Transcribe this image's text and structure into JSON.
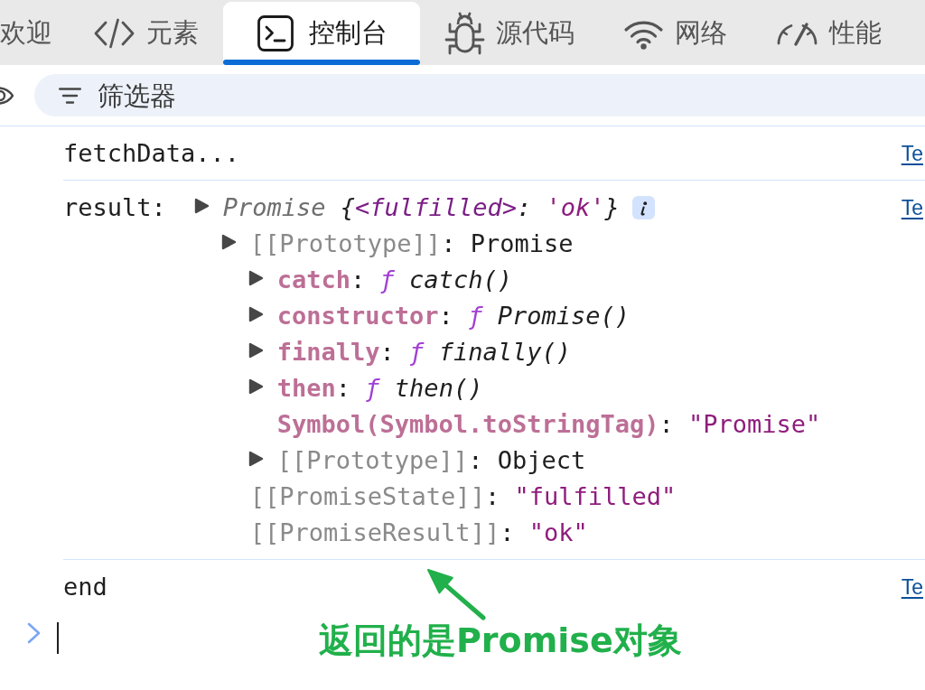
{
  "tabs": [
    {
      "label": "欢迎",
      "kind": "welcome",
      "selected": false
    },
    {
      "label": "元素",
      "kind": "elements",
      "selected": false
    },
    {
      "label": "控制台",
      "kind": "console",
      "selected": true
    },
    {
      "label": "源代码",
      "kind": "sources",
      "selected": false
    },
    {
      "label": "网络",
      "kind": "network",
      "selected": false
    },
    {
      "label": "性能",
      "kind": "performance",
      "selected": false
    }
  ],
  "filter": {
    "placeholder": "筛选器"
  },
  "messages": [
    {
      "kind": "text",
      "text": "fetchData...",
      "source": "Te"
    },
    {
      "kind": "object",
      "label": "result:",
      "expandable": true,
      "parts": [
        {
          "kind": "class",
          "text": "Promise "
        },
        {
          "kind": "punct",
          "text": "{"
        },
        {
          "kind": "tag",
          "text": "<fulfilled>"
        },
        {
          "kind": "punct",
          "text": ": "
        },
        {
          "kind": "str",
          "text": "'ok'"
        },
        {
          "kind": "punct",
          "text": "}"
        }
      ],
      "source": "Te",
      "children": [
        {
          "expandable": true,
          "parts": [
            {
              "kind": "internal",
              "text": "[[Prototype]]"
            },
            {
              "kind": "punct",
              "text": ": "
            },
            {
              "kind": "plain",
              "text": "Promise"
            }
          ],
          "children": [
            {
              "expandable": true,
              "parts": [
                {
                  "kind": "key",
                  "text": "catch"
                },
                {
                  "kind": "punct",
                  "text": ": "
                },
                {
                  "kind": "fn",
                  "text": "ƒ "
                },
                {
                  "kind": "call",
                  "text": "catch()"
                }
              ]
            },
            {
              "expandable": true,
              "parts": [
                {
                  "kind": "key",
                  "text": "constructor"
                },
                {
                  "kind": "punct",
                  "text": ": "
                },
                {
                  "kind": "fn",
                  "text": "ƒ "
                },
                {
                  "kind": "call",
                  "text": "Promise()"
                }
              ]
            },
            {
              "expandable": true,
              "parts": [
                {
                  "kind": "key",
                  "text": "finally"
                },
                {
                  "kind": "punct",
                  "text": ": "
                },
                {
                  "kind": "fn",
                  "text": "ƒ "
                },
                {
                  "kind": "call",
                  "text": "finally()"
                }
              ]
            },
            {
              "expandable": true,
              "parts": [
                {
                  "kind": "key",
                  "text": "then"
                },
                {
                  "kind": "punct",
                  "text": ": "
                },
                {
                  "kind": "fn",
                  "text": "ƒ "
                },
                {
                  "kind": "call",
                  "text": "then()"
                }
              ]
            },
            {
              "expandable": false,
              "parts": [
                {
                  "kind": "key",
                  "text": "Symbol(Symbol.toStringTag)"
                },
                {
                  "kind": "punct",
                  "text": ": "
                },
                {
                  "kind": "str",
                  "text": "\"Promise\""
                }
              ]
            },
            {
              "expandable": true,
              "parts": [
                {
                  "kind": "internal",
                  "text": "[[Prototype]]"
                },
                {
                  "kind": "punct",
                  "text": ": "
                },
                {
                  "kind": "plain",
                  "text": "Object"
                }
              ]
            }
          ]
        },
        {
          "expandable": false,
          "parts": [
            {
              "kind": "internal",
              "text": "[[PromiseState]]"
            },
            {
              "kind": "punct",
              "text": ": "
            },
            {
              "kind": "str",
              "text": "\"fulfilled\""
            }
          ]
        },
        {
          "expandable": false,
          "parts": [
            {
              "kind": "internal",
              "text": "[[PromiseResult]]"
            },
            {
              "kind": "punct",
              "text": ": "
            },
            {
              "kind": "str",
              "text": "\"ok\""
            }
          ]
        }
      ]
    },
    {
      "kind": "text",
      "text": "end",
      "source": "Te"
    }
  ],
  "annotation": {
    "text": "返回的是Promise对象"
  }
}
